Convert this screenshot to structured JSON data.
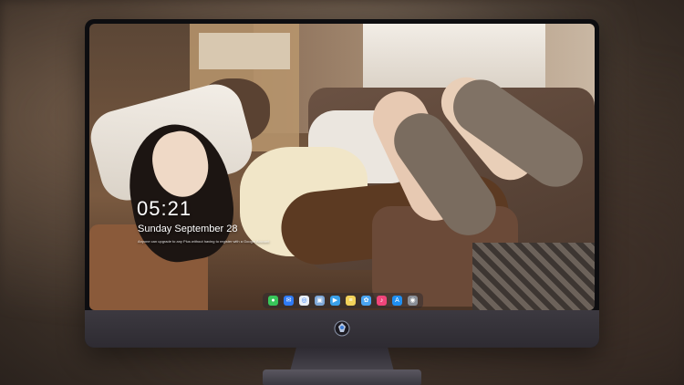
{
  "lockscreen": {
    "time": "05:21",
    "date": "Sunday September  28",
    "message": "Anyone can upgrade to any Plus without having to register with a Google Account"
  },
  "dock": {
    "apps": [
      {
        "name": "messages-icon",
        "glyph": "●",
        "color": "#38c65a"
      },
      {
        "name": "mail-icon",
        "glyph": "✉",
        "color": "#2f7bf6"
      },
      {
        "name": "safari-icon",
        "glyph": "◎",
        "color": "#e9eef5"
      },
      {
        "name": "finder-icon",
        "glyph": "▣",
        "color": "#7fa8d8"
      },
      {
        "name": "videos-icon",
        "glyph": "▶",
        "color": "#3aa0e8"
      },
      {
        "name": "notes-icon",
        "glyph": "≡",
        "color": "#f3d25a"
      },
      {
        "name": "photos-icon",
        "glyph": "✿",
        "color": "#4aa4f0"
      },
      {
        "name": "music-icon",
        "glyph": "♪",
        "color": "#f0457a"
      },
      {
        "name": "app-store-icon",
        "glyph": "A",
        "color": "#1f8ff2"
      },
      {
        "name": "camera-icon",
        "glyph": "◉",
        "color": "#8a8f98"
      }
    ]
  },
  "colors": {
    "monitor_bezel": "#0d0d10",
    "monitor_chin": "#3c3940",
    "stand": "#4a4750"
  }
}
